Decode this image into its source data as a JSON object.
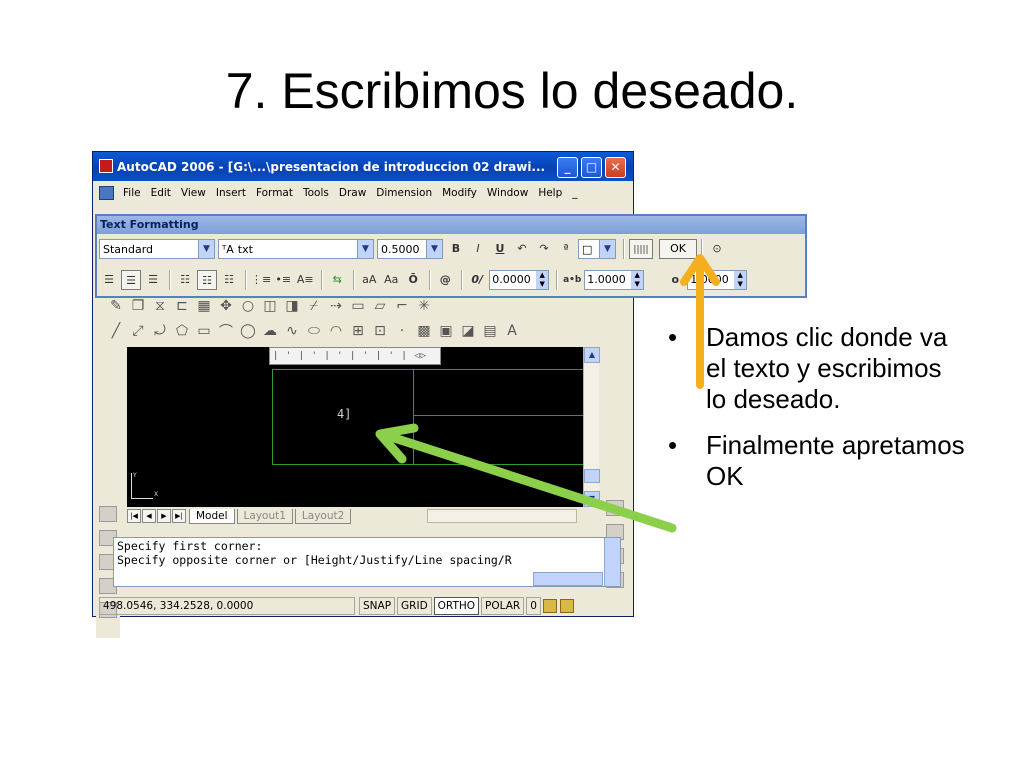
{
  "slide": {
    "title": "7. Escribimos lo deseado.",
    "bullets": [
      "Damos clic donde va el texto y escribimos lo deseado.",
      "Finalmente apretamos OK"
    ]
  },
  "window": {
    "title": "AutoCAD 2006 - [G:\\...\\presentacion de introduccion 02 drawi...",
    "buttons": {
      "minimize": "_",
      "maximize": "□",
      "close": "✕"
    },
    "menu": [
      "File",
      "Edit",
      "View",
      "Insert",
      "Format",
      "Tools",
      "Draw",
      "Dimension",
      "Modify",
      "Window",
      "Help"
    ],
    "menu_doc_close": "_"
  },
  "text_formatting": {
    "title": "Text Formatting",
    "style": "Standard",
    "font": "txt",
    "font_prefix": "ᵀA",
    "height": "0.5000",
    "bold": "B",
    "italic": "I",
    "underline": "U",
    "undo": "↶",
    "redo": "↷",
    "stack": "ª",
    "color_swatch": "□",
    "ruler_btn": "|||||",
    "ok": "OK",
    "options": "⊙",
    "case_upper": "aA",
    "case_lower": "Aa",
    "overline": "Ō",
    "symbol": "@",
    "oblique_label": "0/",
    "oblique": "0.0000",
    "tracking_label": "a•b",
    "tracking": "1.0000",
    "width_label": "o",
    "width": "1.0000"
  },
  "drawing": {
    "typed_text": "4]",
    "ruler_ticks": "| ' | ' | ' | ' | ' |",
    "ruler_arrows": "◁▷",
    "ucs_y": "Y",
    "ucs_x": "X"
  },
  "layout_tabs": [
    "Model",
    "Layout1",
    "Layout2"
  ],
  "command_lines": [
    "Specify first corner:",
    "Specify opposite corner or [Height/Justify/Line spacing/R"
  ],
  "status": {
    "coords": "498.0546, 334.2528, 0.0000",
    "buttons": [
      "SNAP",
      "GRID",
      "ORTHO",
      "POLAR"
    ],
    "extra": "0"
  },
  "colors": {
    "arrow_yellow": "#f4b01c",
    "arrow_green": "#8ccf4a",
    "drawing_bg": "#000000",
    "entity_green": "#2e9b2e"
  }
}
